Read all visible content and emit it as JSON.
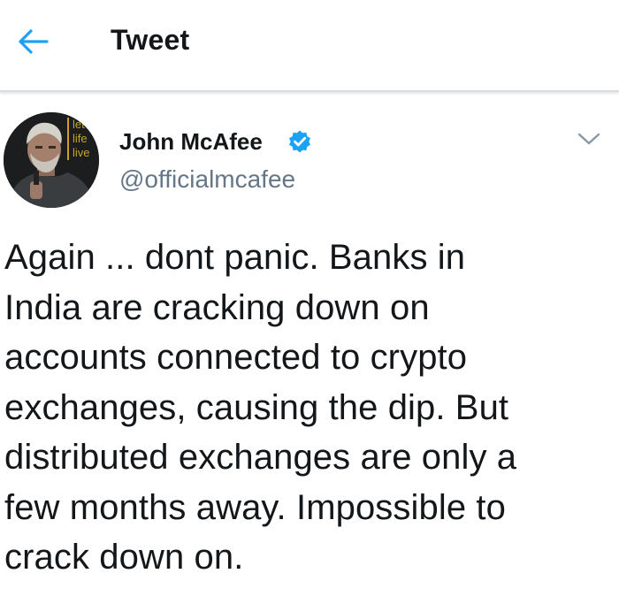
{
  "header": {
    "back_icon": "arrow-left-icon",
    "title": "Tweet"
  },
  "tweet": {
    "author": {
      "avatar_text": "let\nlife\nlive",
      "name": "John McAfee",
      "verified_icon": "verified-badge-icon",
      "handle": "@officialmcafee"
    },
    "menu_icon": "chevron-down-icon",
    "text": "Again ... dont panic. Banks in\nIndia are cracking down on\naccounts connected to crypto\nexchanges, causing the dip. But\ndistributed exchanges are only a\nfew months away. Impossible to\ncrack down on."
  },
  "colors": {
    "accent": "#1da1f2",
    "text": "#14171a",
    "secondary_text": "#657786",
    "divider": "#d8dcdf"
  }
}
